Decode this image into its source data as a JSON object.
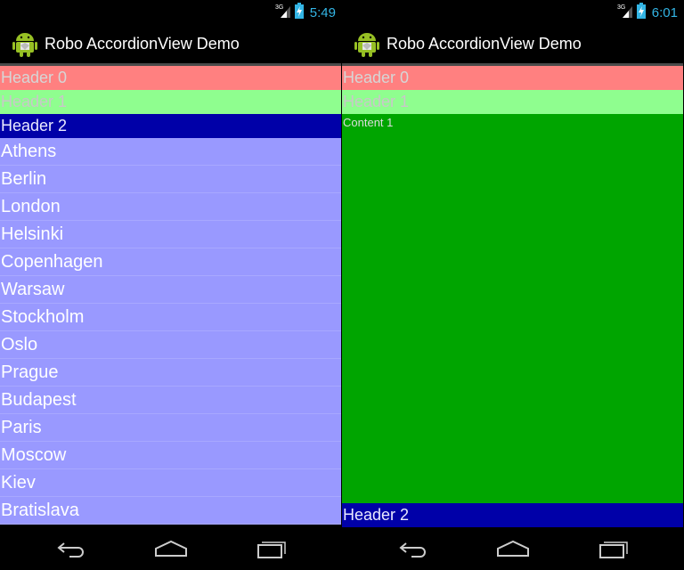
{
  "colors": {
    "status_time": "#33b5e5",
    "header0_bg": "#ff8080",
    "header1_bg": "#8ffe8f",
    "header2_bg": "#0000a8",
    "list_bg": "#9999ff",
    "content_bg": "#00a500"
  },
  "left": {
    "time": "5:49",
    "title": "Robo AccordionView Demo",
    "headers": [
      "Header 0",
      "Header 1",
      "Header 2"
    ],
    "cities": [
      "Athens",
      "Berlin",
      "London",
      "Helsinki",
      "Copenhagen",
      "Warsaw",
      "Stockholm",
      "Oslo",
      "Prague",
      "Budapest",
      "Paris",
      "Moscow",
      "Kiev",
      "Bratislava"
    ]
  },
  "right": {
    "time": "6:01",
    "title": "Robo AccordionView Demo",
    "headers": [
      "Header 0",
      "Header 1",
      "Header 2"
    ],
    "content_label": "Content 1"
  },
  "icons": {
    "signal": "signal-3g-icon",
    "battery": "battery-charging-icon",
    "app": "android-icon",
    "back": "back-icon",
    "home": "home-icon",
    "recents": "recents-icon"
  }
}
